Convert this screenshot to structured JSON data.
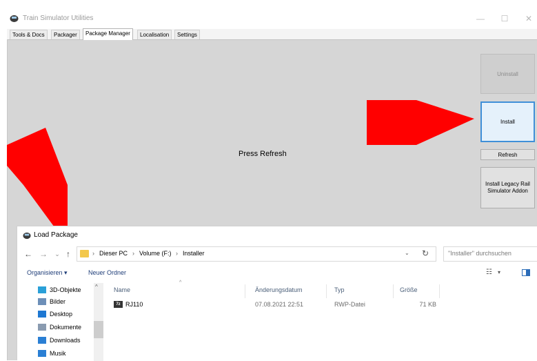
{
  "app": {
    "title": "Train Simulator Utilities",
    "window_controls": {
      "minimize": "—",
      "maximize": "☐",
      "close": "✕"
    }
  },
  "tabs": [
    {
      "label": "Tools & Docs"
    },
    {
      "label": "Packager"
    },
    {
      "label": "Package Manager",
      "active": true
    },
    {
      "label": "Localisation"
    },
    {
      "label": "Settings"
    }
  ],
  "main": {
    "status_text": "Press Refresh",
    "buttons": {
      "uninstall": "Uninstall",
      "install": "Install",
      "refresh": "Refresh",
      "legacy": "Install Legacy Rail Simulator Addon"
    }
  },
  "dialog": {
    "title": "Load Package",
    "nav": {
      "back": "←",
      "forward": "→",
      "recent": "⌄",
      "up": "↑"
    },
    "breadcrumb": [
      "Dieser PC",
      "Volume (F:)",
      "Installer"
    ],
    "search_placeholder": "\"Installer\" durchsuchen",
    "toolbar": {
      "organize": "Organisieren ▾",
      "new_folder": "Neuer Ordner"
    },
    "nav_pane": [
      {
        "label": "3D-Objekte",
        "icon": "3d-objects-icon",
        "color": "#2aa0d8"
      },
      {
        "label": "Bilder",
        "icon": "pictures-icon",
        "color": "#6d8fb8"
      },
      {
        "label": "Desktop",
        "icon": "desktop-icon",
        "color": "#1e78d2"
      },
      {
        "label": "Dokumente",
        "icon": "documents-icon",
        "color": "#8a9bb0"
      },
      {
        "label": "Downloads",
        "icon": "downloads-icon",
        "color": "#2a7fd4"
      },
      {
        "label": "Musik",
        "icon": "music-icon",
        "color": "#2a7fd4"
      }
    ],
    "columns": [
      "Name",
      "Änderungsdatum",
      "Typ",
      "Größe"
    ],
    "files": [
      {
        "name": "RJ110",
        "modified": "07.08.2021 22:51",
        "type": "RWP-Datei",
        "size": "71 KB",
        "icon_text": "7z"
      }
    ]
  },
  "colors": {
    "arrow": "#ff0000",
    "accent": "#3f8fd8"
  }
}
